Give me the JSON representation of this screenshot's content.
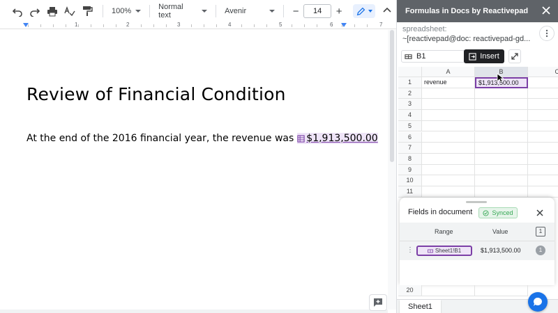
{
  "toolbar": {
    "zoom": "100%",
    "style": "Normal text",
    "font": "Avenir",
    "font_size": "14",
    "minus": "−",
    "plus": "+"
  },
  "ruler": {
    "numbers": [
      "1",
      "2",
      "3",
      "4",
      "5",
      "6",
      "7"
    ]
  },
  "document": {
    "title": "Review of Financial Condition",
    "paragraph_text": "At the end of the 2016 financial year, the revenue was",
    "field_value": "$1,913,500.00"
  },
  "panel": {
    "title": "Formulas in Docs by Reactivepad",
    "spreadsheet_label": "spreadsheet:",
    "spreadsheet_name": "~[reactivepad@doc: reactivepad-gd...",
    "cell_ref": "B1",
    "insert_label": "Insert"
  },
  "grid": {
    "columns": [
      "A",
      "B",
      "C"
    ],
    "rows": [
      "1",
      "2",
      "3",
      "4",
      "5",
      "6",
      "7",
      "8",
      "9",
      "10",
      "11"
    ],
    "cells": {
      "A1": "revenue",
      "B1": "$1,913,500.00"
    },
    "extra_row": "20"
  },
  "fields": {
    "title": "Fields in document",
    "status": "Synced",
    "col_range": "Range",
    "col_value": "Value",
    "count": "1",
    "rows": [
      {
        "range": "Sheet1!B1",
        "value": "$1,913,500.00",
        "count": "1"
      }
    ]
  },
  "sheet_tab": "Sheet1",
  "colors": {
    "accent_purple": "#7b3fa6",
    "chip_bg": "#eee4f7",
    "synced_green": "#34a853",
    "primary_blue": "#1a73e8"
  }
}
